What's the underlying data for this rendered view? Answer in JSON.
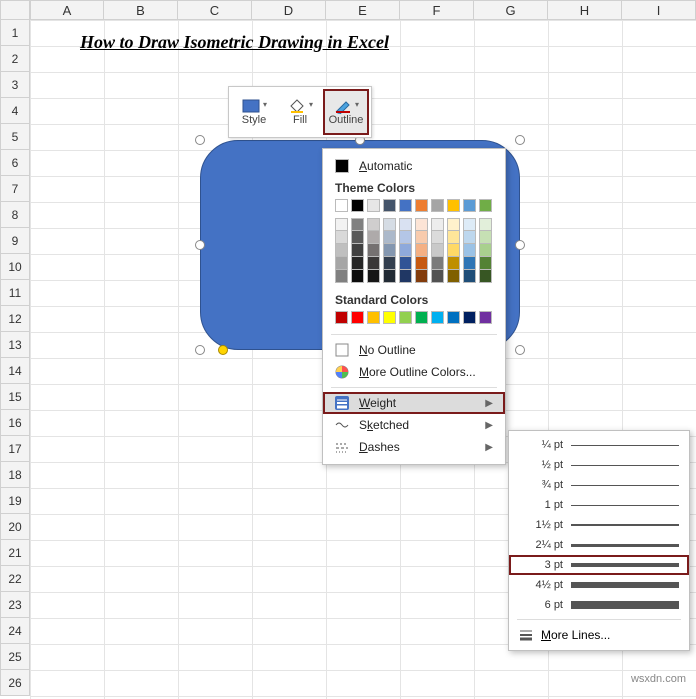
{
  "sheet": {
    "columns": [
      "A",
      "B",
      "C",
      "D",
      "E",
      "F",
      "G",
      "H",
      "I"
    ],
    "rows": [
      "1",
      "2",
      "3",
      "4",
      "5",
      "6",
      "7",
      "8",
      "9",
      "10",
      "11",
      "12",
      "13",
      "14",
      "15",
      "16",
      "17",
      "18",
      "19",
      "20",
      "21",
      "22",
      "23",
      "24",
      "25",
      "26"
    ],
    "title": "How to Draw Isometric Drawing in Excel"
  },
  "mini_toolbar": {
    "style": "Style",
    "fill": "Fill",
    "outline": "Outline"
  },
  "outline_menu": {
    "automatic": "Automatic",
    "theme_colors_header": "Theme Colors",
    "standard_colors_header": "Standard Colors",
    "no_outline": "No Outline",
    "more_colors": "More Outline Colors...",
    "weight": "Weight",
    "sketched": "Sketched",
    "dashes": "Dashes",
    "theme_base": [
      "#ffffff",
      "#000000",
      "#e7e6e6",
      "#44546a",
      "#4472c4",
      "#ed7d31",
      "#a5a5a5",
      "#ffc000",
      "#5b9bd5",
      "#70ad47"
    ],
    "theme_shades": [
      [
        "#f2f2f2",
        "#d9d9d9",
        "#bfbfbf",
        "#a6a6a6",
        "#808080"
      ],
      [
        "#808080",
        "#595959",
        "#404040",
        "#262626",
        "#0d0d0d"
      ],
      [
        "#d0cece",
        "#aeaaaa",
        "#757171",
        "#3a3838",
        "#161616"
      ],
      [
        "#d5dce4",
        "#acb9ca",
        "#8497b0",
        "#333f4f",
        "#222b35"
      ],
      [
        "#d9e1f2",
        "#b4c6e7",
        "#8ea9db",
        "#305496",
        "#203764"
      ],
      [
        "#fce4d6",
        "#f8cbad",
        "#f4b084",
        "#c65911",
        "#833c0c"
      ],
      [
        "#ededed",
        "#dbdbdb",
        "#c9c9c9",
        "#7b7b7b",
        "#525252"
      ],
      [
        "#fff2cc",
        "#ffe699",
        "#ffd966",
        "#bf8f00",
        "#806000"
      ],
      [
        "#ddebf7",
        "#bdd7ee",
        "#9bc2e6",
        "#2f75b5",
        "#1f4e78"
      ],
      [
        "#e2efda",
        "#c6e0b4",
        "#a9d08e",
        "#548235",
        "#375623"
      ]
    ],
    "standard": [
      "#c00000",
      "#ff0000",
      "#ffc000",
      "#ffff00",
      "#92d050",
      "#00b050",
      "#00b0f0",
      "#0070c0",
      "#002060",
      "#7030a0"
    ]
  },
  "weight_menu": {
    "options": [
      {
        "label": "¼ pt",
        "px": 1
      },
      {
        "label": "½ pt",
        "px": 1
      },
      {
        "label": "¾ pt",
        "px": 1
      },
      {
        "label": "1 pt",
        "px": 1
      },
      {
        "label": "1½ pt",
        "px": 2
      },
      {
        "label": "2¼ pt",
        "px": 3
      },
      {
        "label": "3 pt",
        "px": 4
      },
      {
        "label": "4½ pt",
        "px": 6
      },
      {
        "label": "6 pt",
        "px": 8
      }
    ],
    "selected_index": 6,
    "more_lines": "More Lines..."
  },
  "watermark": "wsxdn.com"
}
